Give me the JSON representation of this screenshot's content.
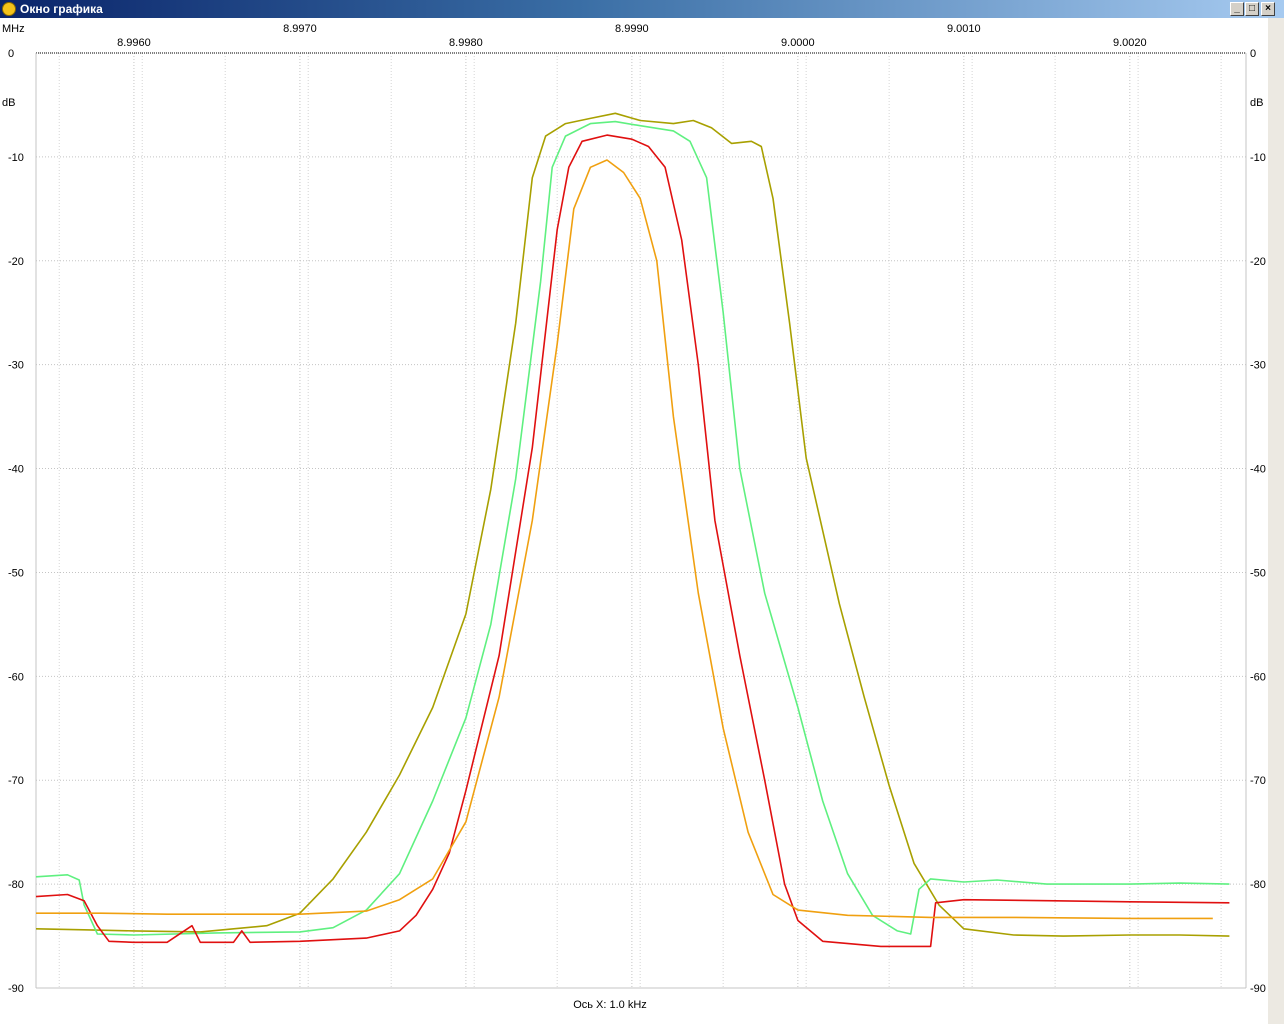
{
  "window": {
    "title": "Окно графика",
    "buttons": {
      "minimize": "_",
      "maximize": "□",
      "close": "×"
    }
  },
  "chart_data": {
    "type": "line",
    "x_unit_label": "MHz",
    "y_unit_label": "dB",
    "x_axis_note": "Ось X: 1.0 kHz",
    "xlim": [
      8.99541,
      9.0027
    ],
    "ylim": [
      -90,
      0
    ],
    "x_ticks": [
      {
        "value": 8.996,
        "label": "8.9960",
        "row": "bottom"
      },
      {
        "value": 8.997,
        "label": "8.9970",
        "row": "top"
      },
      {
        "value": 8.998,
        "label": "8.9980",
        "row": "bottom"
      },
      {
        "value": 8.999,
        "label": "8.9990",
        "row": "top"
      },
      {
        "value": 9.0,
        "label": "9.0000",
        "row": "bottom"
      },
      {
        "value": 9.001,
        "label": "9.0010",
        "row": "top"
      },
      {
        "value": 9.002,
        "label": "9.0020",
        "row": "bottom"
      }
    ],
    "y_ticks": [
      0,
      -10,
      -20,
      -30,
      -40,
      -50,
      -60,
      -70,
      -80,
      -90
    ],
    "x_grid_minor": [
      8.99555,
      8.99605,
      8.99655,
      8.99705,
      8.99755,
      8.99805,
      8.99855,
      8.99905,
      8.99955,
      9.00005,
      9.00055,
      9.00105,
      9.00155,
      9.00205,
      9.00255
    ],
    "grid": true,
    "legend": "none",
    "series": [
      {
        "color": "#a8a000",
        "points": [
          [
            8.99541,
            -84.3
          ],
          [
            8.9957,
            -84.4
          ],
          [
            8.996,
            -84.5
          ],
          [
            8.9964,
            -84.6
          ],
          [
            8.9968,
            -84.0
          ],
          [
            8.997,
            -82.8
          ],
          [
            8.9972,
            -79.5
          ],
          [
            8.9974,
            -75.0
          ],
          [
            8.9976,
            -69.5
          ],
          [
            8.9978,
            -63.0
          ],
          [
            8.998,
            -54.0
          ],
          [
            8.99815,
            -42.0
          ],
          [
            8.9983,
            -26.0
          ],
          [
            8.9984,
            -12.0
          ],
          [
            8.99848,
            -8.0
          ],
          [
            8.9986,
            -6.8
          ],
          [
            8.99875,
            -6.3
          ],
          [
            8.9989,
            -5.8
          ],
          [
            8.99905,
            -6.5
          ],
          [
            8.99925,
            -6.8
          ],
          [
            8.99937,
            -6.5
          ],
          [
            8.99948,
            -7.2
          ],
          [
            8.9996,
            -8.7
          ],
          [
            8.99972,
            -8.5
          ],
          [
            8.99978,
            -9.0
          ],
          [
            8.99985,
            -14.0
          ],
          [
            8.99995,
            -26.0
          ],
          [
            9.00005,
            -39.0
          ],
          [
            9.00025,
            -53.0
          ],
          [
            9.0004,
            -62.0
          ],
          [
            9.00055,
            -70.5
          ],
          [
            9.0007,
            -78.0
          ],
          [
            9.00085,
            -82.0
          ],
          [
            9.001,
            -84.3
          ],
          [
            9.0013,
            -84.9
          ],
          [
            9.0016,
            -85.0
          ],
          [
            9.002,
            -84.9
          ],
          [
            9.0023,
            -84.9
          ],
          [
            9.0026,
            -85.0
          ]
        ]
      },
      {
        "color": "#5ff080",
        "points": [
          [
            8.99541,
            -79.3
          ],
          [
            8.9956,
            -79.1
          ],
          [
            8.99567,
            -79.6
          ],
          [
            8.9957,
            -82.0
          ],
          [
            8.99578,
            -84.8
          ],
          [
            8.996,
            -84.9
          ],
          [
            8.9965,
            -84.7
          ],
          [
            8.997,
            -84.6
          ],
          [
            8.9972,
            -84.2
          ],
          [
            8.9974,
            -82.5
          ],
          [
            8.9976,
            -79.0
          ],
          [
            8.9978,
            -72.0
          ],
          [
            8.998,
            -64.0
          ],
          [
            8.99815,
            -55.0
          ],
          [
            8.9983,
            -41.0
          ],
          [
            8.99845,
            -22.0
          ],
          [
            8.99852,
            -11.0
          ],
          [
            8.9986,
            -8.0
          ],
          [
            8.99875,
            -6.8
          ],
          [
            8.9989,
            -6.6
          ],
          [
            8.99905,
            -7.0
          ],
          [
            8.99925,
            -7.5
          ],
          [
            8.99935,
            -8.5
          ],
          [
            8.99945,
            -12.0
          ],
          [
            8.99955,
            -25.0
          ],
          [
            8.99965,
            -40.0
          ],
          [
            8.9998,
            -52.0
          ],
          [
            9.0,
            -63.0
          ],
          [
            9.00015,
            -72.0
          ],
          [
            9.0003,
            -79.0
          ],
          [
            9.00045,
            -83.0
          ],
          [
            9.0006,
            -84.5
          ],
          [
            9.00068,
            -84.8
          ],
          [
            9.00073,
            -80.5
          ],
          [
            9.0008,
            -79.5
          ],
          [
            9.001,
            -79.8
          ],
          [
            9.0012,
            -79.6
          ],
          [
            9.0015,
            -80.0
          ],
          [
            9.002,
            -80.0
          ],
          [
            9.0023,
            -79.9
          ],
          [
            9.0026,
            -80.0
          ]
        ]
      },
      {
        "color": "#e01010",
        "points": [
          [
            8.99541,
            -81.2
          ],
          [
            8.9956,
            -81.0
          ],
          [
            8.9957,
            -81.6
          ],
          [
            8.99578,
            -84.0
          ],
          [
            8.99585,
            -85.5
          ],
          [
            8.996,
            -85.6
          ],
          [
            8.9962,
            -85.6
          ],
          [
            8.99635,
            -84.0
          ],
          [
            8.9964,
            -85.6
          ],
          [
            8.9966,
            -85.6
          ],
          [
            8.99665,
            -84.5
          ],
          [
            8.9967,
            -85.6
          ],
          [
            8.997,
            -85.5
          ],
          [
            8.9974,
            -85.2
          ],
          [
            8.9976,
            -84.5
          ],
          [
            8.9977,
            -83.0
          ],
          [
            8.9978,
            -80.5
          ],
          [
            8.9979,
            -77.0
          ],
          [
            8.998,
            -71.0
          ],
          [
            8.9982,
            -58.0
          ],
          [
            8.9984,
            -38.0
          ],
          [
            8.99855,
            -17.0
          ],
          [
            8.99862,
            -11.0
          ],
          [
            8.9987,
            -8.5
          ],
          [
            8.99885,
            -7.9
          ],
          [
            8.999,
            -8.3
          ],
          [
            8.9991,
            -9.0
          ],
          [
            8.9992,
            -11.0
          ],
          [
            8.9993,
            -18.0
          ],
          [
            8.9994,
            -30.0
          ],
          [
            8.9995,
            -45.0
          ],
          [
            8.99965,
            -58.0
          ],
          [
            8.9998,
            -70.0
          ],
          [
            8.99992,
            -80.0
          ],
          [
            9.0,
            -83.5
          ],
          [
            9.00015,
            -85.5
          ],
          [
            9.0005,
            -86.0
          ],
          [
            9.0008,
            -86.0
          ],
          [
            9.00083,
            -81.8
          ],
          [
            9.001,
            -81.5
          ],
          [
            9.0015,
            -81.6
          ],
          [
            9.002,
            -81.7
          ],
          [
            9.0026,
            -81.8
          ]
        ]
      },
      {
        "color": "#f0a010",
        "points": [
          [
            8.99541,
            -82.8
          ],
          [
            8.9958,
            -82.8
          ],
          [
            8.9962,
            -82.9
          ],
          [
            8.9966,
            -82.9
          ],
          [
            8.997,
            -82.9
          ],
          [
            8.9974,
            -82.6
          ],
          [
            8.9976,
            -81.5
          ],
          [
            8.9978,
            -79.5
          ],
          [
            8.998,
            -74.0
          ],
          [
            8.9982,
            -62.0
          ],
          [
            8.9984,
            -45.0
          ],
          [
            8.99855,
            -28.0
          ],
          [
            8.99865,
            -15.0
          ],
          [
            8.99875,
            -11.0
          ],
          [
            8.99885,
            -10.3
          ],
          [
            8.99895,
            -11.5
          ],
          [
            8.99905,
            -14.0
          ],
          [
            8.99915,
            -20.0
          ],
          [
            8.99925,
            -35.0
          ],
          [
            8.9994,
            -52.0
          ],
          [
            8.99955,
            -65.0
          ],
          [
            8.9997,
            -75.0
          ],
          [
            8.99985,
            -81.0
          ],
          [
            9.0,
            -82.5
          ],
          [
            9.0003,
            -83.0
          ],
          [
            9.0008,
            -83.2
          ],
          [
            9.0013,
            -83.2
          ],
          [
            9.002,
            -83.3
          ],
          [
            9.0025,
            -83.3
          ]
        ]
      }
    ]
  }
}
